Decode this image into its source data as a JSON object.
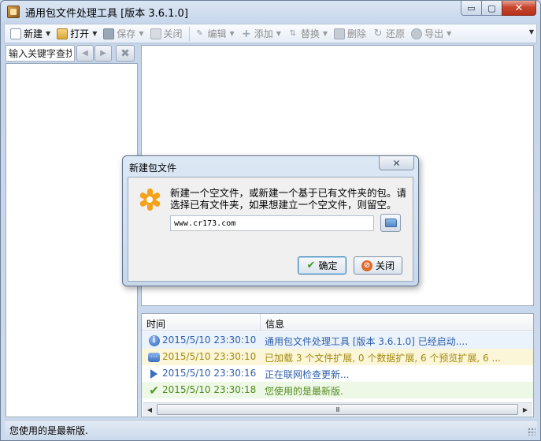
{
  "window": {
    "title": "通用包文件处理工具 [版本 3.6.1.0]",
    "controls": {
      "minimize": "▭",
      "maximize": "▢",
      "close": "✕"
    }
  },
  "toolbar": {
    "items": [
      {
        "label": "新建",
        "icon": "new-file-icon",
        "enabled": true,
        "dropdown": true
      },
      {
        "label": "打开",
        "icon": "open-folder-icon",
        "enabled": true,
        "dropdown": true
      },
      {
        "label": "保存",
        "icon": "save-icon",
        "enabled": false,
        "dropdown": true
      },
      {
        "label": "关闭",
        "icon": "close-doc-icon",
        "enabled": false,
        "dropdown": false
      },
      {
        "label": "编辑",
        "icon": "edit-icon",
        "enabled": false,
        "dropdown": true
      },
      {
        "label": "添加",
        "icon": "add-icon",
        "enabled": false,
        "dropdown": true
      },
      {
        "label": "替换",
        "icon": "replace-icon",
        "enabled": false,
        "dropdown": true
      },
      {
        "label": "删除",
        "icon": "delete-icon",
        "enabled": false,
        "dropdown": false
      },
      {
        "label": "还原",
        "icon": "restore-icon",
        "enabled": false,
        "dropdown": false
      },
      {
        "label": "导出",
        "icon": "export-icon",
        "enabled": false,
        "dropdown": true
      }
    ]
  },
  "search": {
    "placeholder": "输入关键字查找"
  },
  "log": {
    "columns": {
      "time": "时间",
      "info": "信息"
    },
    "rows": [
      {
        "time": "2015/5/10 23:30:10",
        "message": "通用包文件处理工具 [版本 3.6.1.0] 已经启动....",
        "icon": "info-icon"
      },
      {
        "time": "2015/5/10 23:30:10",
        "message": "已加载 3 个文件扩展, 0 个数据扩展, 6 个预览扩展, 6 ...",
        "icon": "message-icon"
      },
      {
        "time": "2015/5/10 23:30:16",
        "message": "正在联网检查更新...",
        "icon": "play-icon"
      },
      {
        "time": "2015/5/10 23:30:18",
        "message": "您使用的是最新版.",
        "icon": "check-icon"
      }
    ],
    "scroll_thumb": "III"
  },
  "status": {
    "text": "您使用的是最新版."
  },
  "dialog": {
    "title": "新建包文件",
    "message": "新建一个空文件，或新建一个基于已有文件夹的包。请选择已有文件夹，如果想建立一个空文件，则留空。",
    "path_value": "www.cr173.com",
    "ok_label": "确定",
    "cancel_label": "关闭",
    "close_glyph": "✕"
  },
  "colors": {
    "info_row_bg": "#eaf2fb",
    "warn_row_bg": "#fbf6d8",
    "success_row_bg": "#eef8e6",
    "info_text": "#2f5fa8",
    "warn_text": "#a38a10",
    "success_text": "#4f8a1e"
  }
}
